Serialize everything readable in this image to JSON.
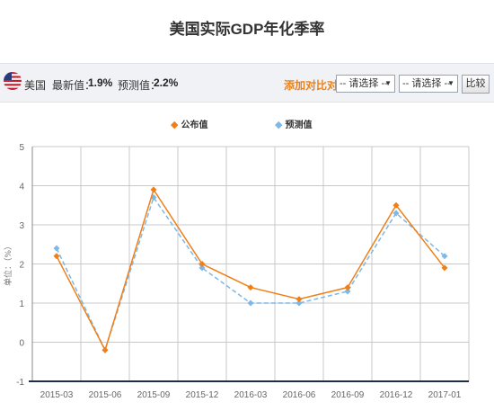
{
  "title": "美国实际GDP年化季率",
  "info_bar": {
    "country": "美国",
    "latest_label": "最新值：",
    "latest_value": "1.9%",
    "forecast_label": "预测值：",
    "forecast_value": "2.2%",
    "add_compare_label": "添加对比对象：",
    "select1": "-- 请选择 --",
    "select2": "-- 请选择 --",
    "compare_button": "比较"
  },
  "chart_data": {
    "type": "line",
    "categories": [
      "2015-03",
      "2015-06",
      "2015-09",
      "2015-12",
      "2016-03",
      "2016-06",
      "2016-09",
      "2016-12",
      "2017-01"
    ],
    "series": [
      {
        "name": "公布值",
        "values": [
          2.2,
          -0.2,
          3.9,
          2.0,
          1.4,
          1.1,
          1.4,
          3.5,
          1.9
        ],
        "color": "#f07f18",
        "style": "solid"
      },
      {
        "name": "预测值",
        "values": [
          2.4,
          -0.2,
          3.7,
          1.9,
          1.0,
          1.0,
          1.3,
          3.3,
          2.2
        ],
        "color": "#7db8e6",
        "style": "dashed"
      }
    ],
    "ylabel": "单位：（%）",
    "ylim": [
      -1,
      5
    ],
    "yticks": [
      "-1",
      "0",
      "1",
      "2",
      "3",
      "4",
      "5"
    ],
    "grid": true,
    "legend_position": "top-center"
  }
}
